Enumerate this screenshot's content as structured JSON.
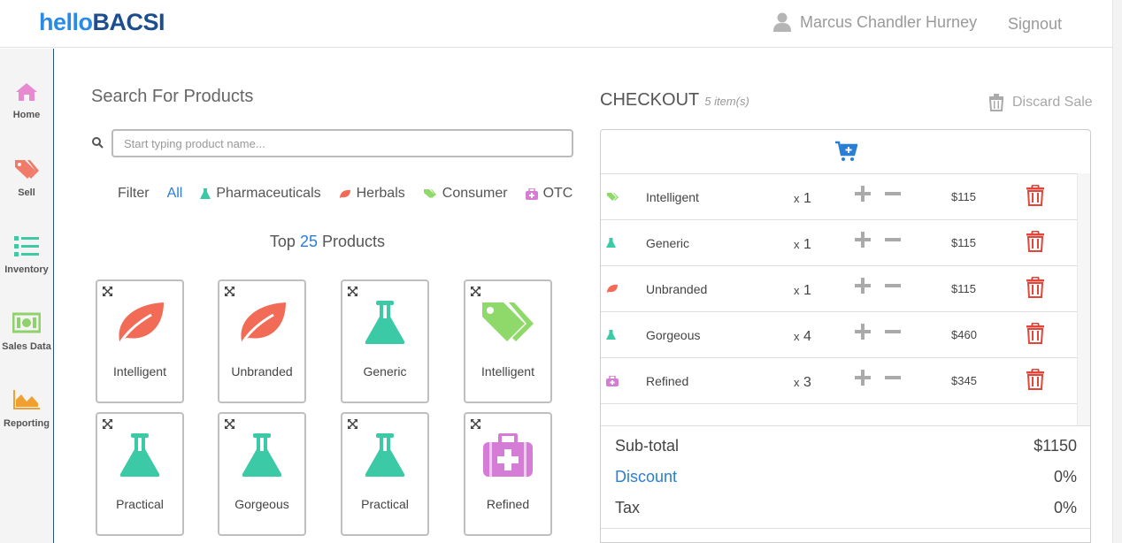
{
  "header": {
    "logo_part1": "hello",
    "logo_part2": "BACSI",
    "user_name": "Marcus Chandler Hurney",
    "signout_label": "Signout"
  },
  "sidebar": {
    "items": [
      {
        "label": "Home",
        "icon": "home-icon",
        "color": "#e86fb8"
      },
      {
        "label": "Sell",
        "icon": "tags-icon",
        "color": "#f07b6a"
      },
      {
        "label": "Inventory",
        "icon": "list-icon",
        "color": "#3fc9a5"
      },
      {
        "label": "Sales Data",
        "icon": "money-icon",
        "color": "#8fd16a"
      },
      {
        "label": "Reporting",
        "icon": "area-chart-icon",
        "color": "#f0a030"
      }
    ]
  },
  "search": {
    "title": "Search For Products",
    "placeholder": "Start typing product name...",
    "value": ""
  },
  "filter": {
    "label": "Filter",
    "all_label": "All",
    "options": [
      {
        "label": "Pharmaceuticals",
        "icon": "flask-icon",
        "color": "#3cc9a5"
      },
      {
        "label": "Herbals",
        "icon": "leaf-icon",
        "color": "#f26b57"
      },
      {
        "label": "Consumer",
        "icon": "tags-icon",
        "color": "#8ed96a"
      },
      {
        "label": "OTC",
        "icon": "medkit-icon",
        "color": "#d57dd6"
      }
    ]
  },
  "top_products": {
    "prefix": "Top",
    "count": "25",
    "suffix": "Products",
    "items": [
      {
        "name": "Intelligent",
        "category": "herbal"
      },
      {
        "name": "Unbranded",
        "category": "herbal"
      },
      {
        "name": "Generic",
        "category": "pharma"
      },
      {
        "name": "Intelligent",
        "category": "consumer"
      },
      {
        "name": "Practical",
        "category": "pharma"
      },
      {
        "name": "Gorgeous",
        "category": "pharma"
      },
      {
        "name": "Practical",
        "category": "pharma"
      },
      {
        "name": "Refined",
        "category": "otc"
      }
    ]
  },
  "checkout": {
    "title": "CHECKOUT",
    "item_count": "5 item(s)",
    "discard_label": "Discard Sale",
    "items": [
      {
        "name": "Intelligent",
        "category": "consumer",
        "qty_prefix": "x",
        "qty": "1",
        "price": "$115"
      },
      {
        "name": "Generic",
        "category": "pharma",
        "qty_prefix": "x",
        "qty": "1",
        "price": "$115"
      },
      {
        "name": "Unbranded",
        "category": "herbal",
        "qty_prefix": "x",
        "qty": "1",
        "price": "$115"
      },
      {
        "name": "Gorgeous",
        "category": "pharma",
        "qty_prefix": "x",
        "qty": "4",
        "price": "$460"
      },
      {
        "name": "Refined",
        "category": "otc",
        "qty_prefix": "x",
        "qty": "3",
        "price": "$345"
      }
    ],
    "subtotal_label": "Sub-total",
    "subtotal_value": "$1150",
    "discount_label": "Discount",
    "discount_value": "0%",
    "tax_label": "Tax",
    "tax_value": "0%"
  },
  "colors": {
    "accent": "#2a7ed3",
    "herbal": "#f26b57",
    "pharma": "#3cc9a5",
    "consumer": "#8ed96a",
    "otc": "#d57dd6",
    "delete": "#e0463a"
  }
}
